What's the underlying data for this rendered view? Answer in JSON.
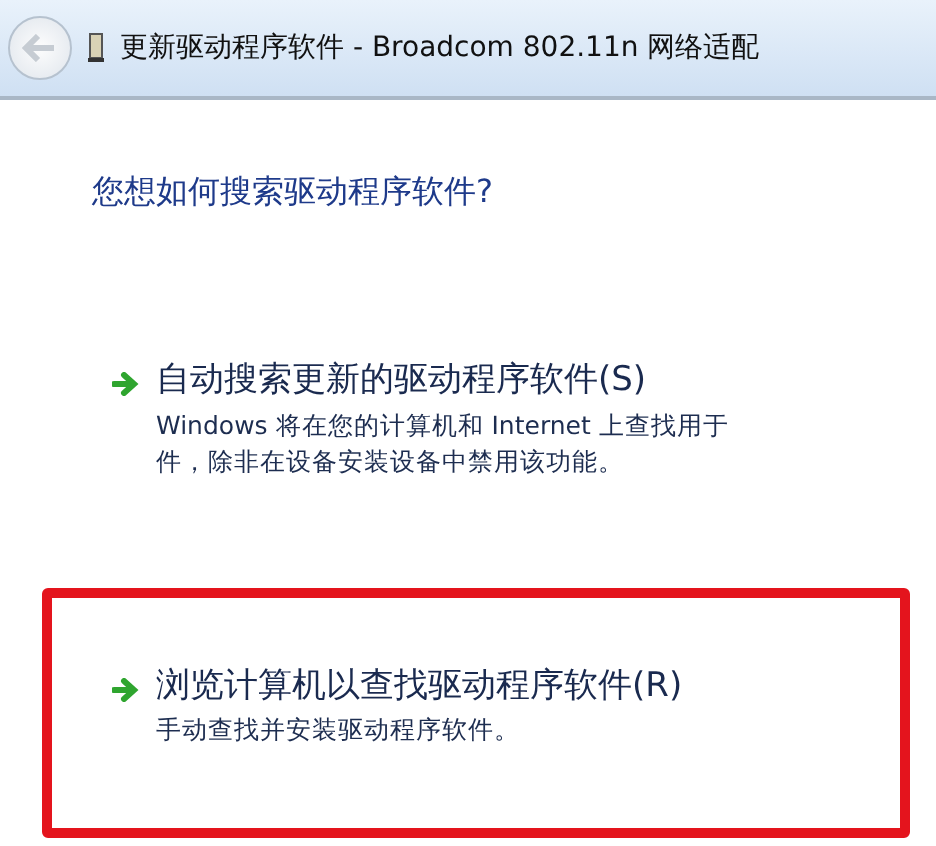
{
  "window": {
    "title": "更新驱动程序软件 - Broadcom 802.11n 网络适配"
  },
  "heading": "您想如何搜索驱动程序软件?",
  "options": [
    {
      "title": "自动搜索更新的驱动程序软件(S)",
      "description": [
        "Windows 将在您的计算机和 Internet 上查找用于",
        "件，除非在设备安装设备中禁用该功能。"
      ],
      "highlighted": false
    },
    {
      "title": "浏览计算机以查找驱动程序软件(R)",
      "description": [
        "手动查找并安装驱动程序软件。"
      ],
      "highlighted": true
    }
  ]
}
